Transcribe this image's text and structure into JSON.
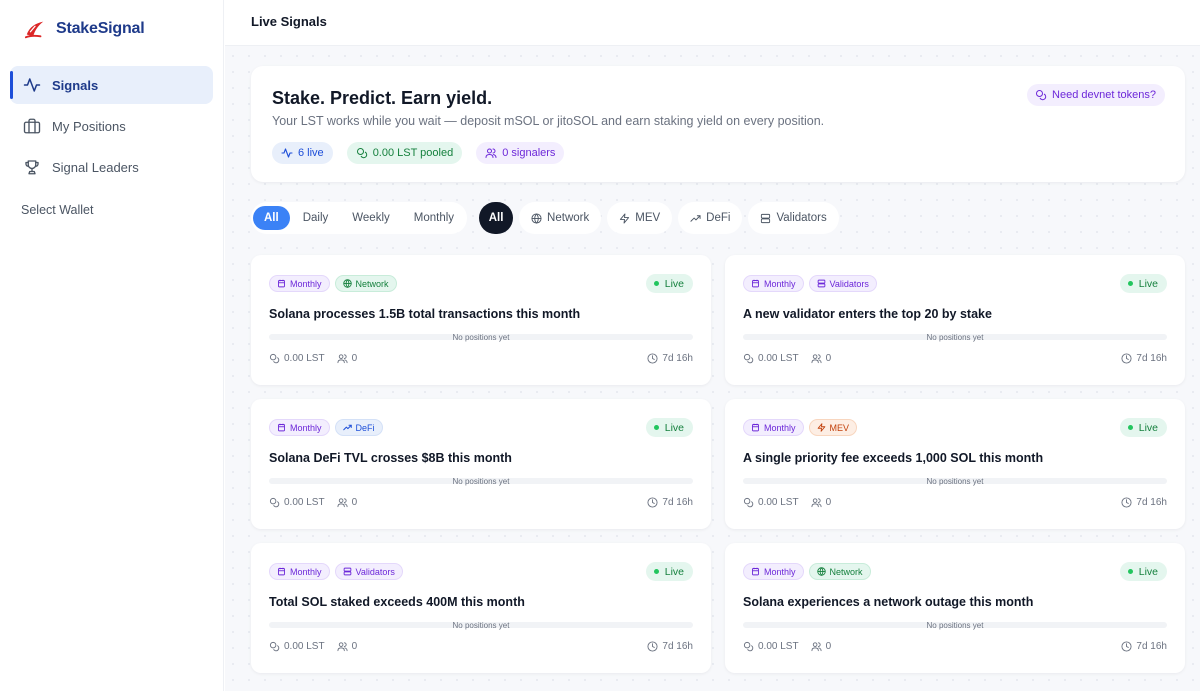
{
  "brand": {
    "name": "StakeSignal"
  },
  "nav": {
    "items": [
      {
        "label": "Signals",
        "icon": "activity-icon",
        "active": true
      },
      {
        "label": "My Positions",
        "icon": "briefcase-icon",
        "active": false
      },
      {
        "label": "Signal Leaders",
        "icon": "trophy-icon",
        "active": false
      }
    ],
    "wallet_label": "Select Wallet"
  },
  "header": {
    "title": "Live Signals"
  },
  "hero": {
    "title": "Stake. Predict. Earn yield.",
    "subtitle": "Your LST works while you wait — deposit mSOL or jitoSOL and earn staking yield on every position.",
    "devnet_label": "Need devnet tokens?",
    "stats": {
      "live": "6 live",
      "pooled": "0.00 LST pooled",
      "signalers": "0 signalers"
    }
  },
  "filters": {
    "periods": [
      "All",
      "Daily",
      "Weekly",
      "Monthly"
    ],
    "active_period": "All",
    "categories": [
      "All",
      "Network",
      "MEV",
      "DeFi",
      "Validators"
    ],
    "active_category": "All"
  },
  "cards": [
    {
      "period": "Monthly",
      "category": "Network",
      "status": "Live",
      "title": "Solana processes 1.5B total transactions this month",
      "progress_text": "No positions yet",
      "pool": "0.00 LST",
      "signalers": "0",
      "time_left": "7d 16h"
    },
    {
      "period": "Monthly",
      "category": "Validators",
      "status": "Live",
      "title": "A new validator enters the top 20 by stake",
      "progress_text": "No positions yet",
      "pool": "0.00 LST",
      "signalers": "0",
      "time_left": "7d 16h"
    },
    {
      "period": "Monthly",
      "category": "DeFi",
      "status": "Live",
      "title": "Solana DeFi TVL crosses $8B this month",
      "progress_text": "No positions yet",
      "pool": "0.00 LST",
      "signalers": "0",
      "time_left": "7d 16h"
    },
    {
      "period": "Monthly",
      "category": "MEV",
      "status": "Live",
      "title": "A single priority fee exceeds 1,000 SOL this month",
      "progress_text": "No positions yet",
      "pool": "0.00 LST",
      "signalers": "0",
      "time_left": "7d 16h"
    },
    {
      "period": "Monthly",
      "category": "Validators",
      "status": "Live",
      "title": "Total SOL staked exceeds 400M this month",
      "progress_text": "No positions yet",
      "pool": "0.00 LST",
      "signalers": "0",
      "time_left": "7d 16h"
    },
    {
      "period": "Monthly",
      "category": "Network",
      "status": "Live",
      "title": "Solana experiences a network outage this month",
      "progress_text": "No positions yet",
      "pool": "0.00 LST",
      "signalers": "0",
      "time_left": "7d 16h"
    }
  ],
  "colors": {
    "accent": "#3b82f6",
    "brand": "#1e3a8a",
    "live": "#22c55e",
    "dark_pill": "#111827"
  }
}
